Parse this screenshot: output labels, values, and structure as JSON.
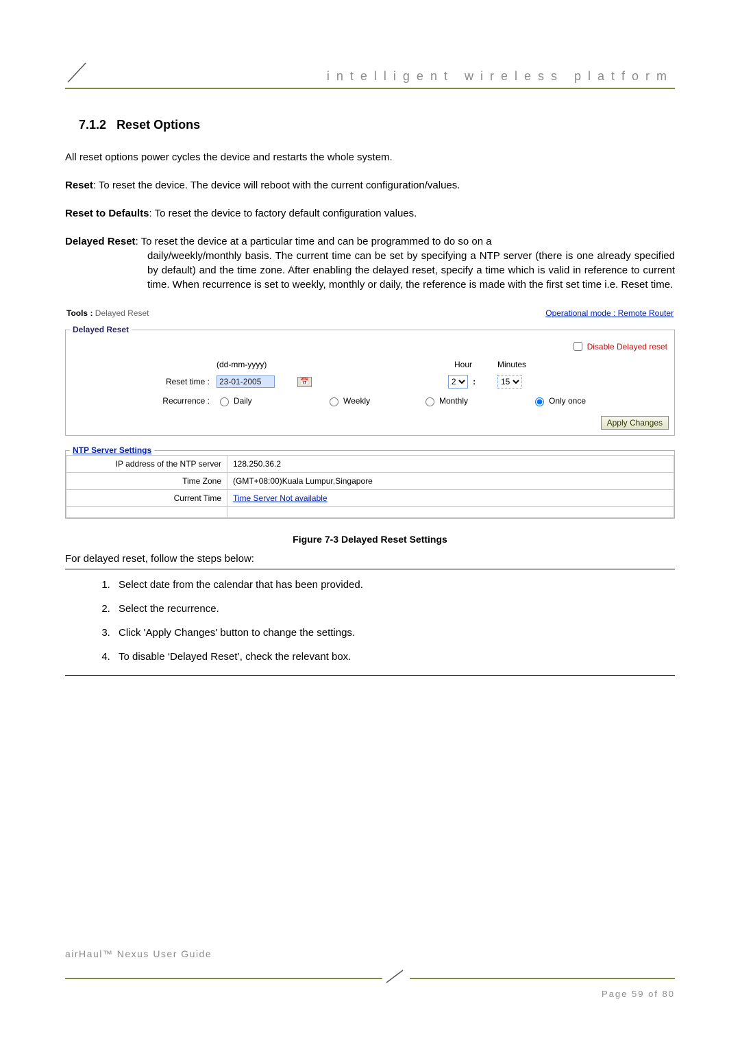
{
  "header": {
    "title": "intelligent  wireless  platform"
  },
  "section": {
    "number": "7.1.2",
    "title": "Reset Options"
  },
  "intro": "All reset options power cycles the device and restarts the whole system.",
  "reset_def": {
    "label": "Reset",
    "body": ": To reset the device. The device will reboot with the current configuration/values."
  },
  "defaults_def": {
    "label": "Reset to Defaults",
    "body": ": To reset the device to factory default configuration values."
  },
  "delayed_def": {
    "label": "Delayed Reset",
    "body_first": ": To reset the device at a particular time and can be programmed to do so on a",
    "body_rest": "daily/weekly/monthly basis. The current time can be set by specifying a NTP server (there is one already specified by default) and the time zone.  After enabling the delayed reset, specify a time which is valid in reference to current time. When recurrence is set to weekly, monthly or daily, the reference is made with the first set time i.e. Reset time."
  },
  "panel": {
    "tools_label": "Tools :",
    "tools_value": "Delayed Reset",
    "op_mode": "Operational mode : Remote Router",
    "legend": "Delayed Reset",
    "disable_label": "Disable Delayed reset",
    "date_format": "(dd-mm-yyyy)",
    "hour_label": "Hour",
    "minutes_label": "Minutes",
    "reset_time_label": "Reset time :",
    "reset_time_value": "23-01-2005",
    "hour_value": "2",
    "min_value": "15",
    "recurrence_label": "Recurrence :",
    "rec_daily": "Daily",
    "rec_weekly": "Weekly",
    "rec_monthly": "Monthly",
    "rec_once": "Only once",
    "apply": "Apply Changes"
  },
  "ntp": {
    "legend": "NTP Server Settings",
    "ip_label": "IP address of the NTP server",
    "ip_value": "128.250.36.2",
    "tz_label": "Time Zone",
    "tz_value": "(GMT+08:00)Kuala Lumpur,Singapore",
    "ct_label": "Current Time",
    "ct_value": "Time Server Not available"
  },
  "figure_caption": "Figure 7-3 Delayed Reset Settings",
  "steps_lead": "For delayed reset, follow the steps below:",
  "steps": [
    "Select date from the calendar that has been provided.",
    "Select the recurrence.",
    "Click 'Apply Changes' button to change the settings.",
    "To disable ‘Delayed Reset’, check the relevant box."
  ],
  "footer": {
    "guide": "airHaul™ Nexus User Guide",
    "page": "Page 59 of 80"
  }
}
